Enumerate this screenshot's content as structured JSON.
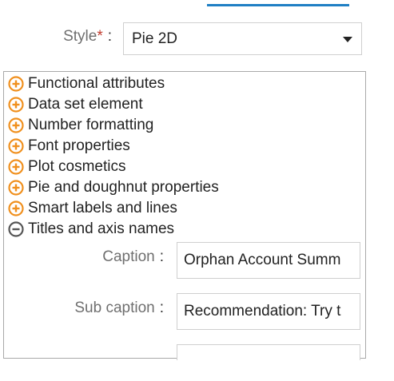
{
  "style": {
    "label": "Style",
    "required_mark": "*",
    "colon": ":",
    "selected": "Pie 2D"
  },
  "tree": [
    {
      "label": "Functional attributes",
      "state": "collapsed"
    },
    {
      "label": "Data set element",
      "state": "collapsed"
    },
    {
      "label": "Number formatting",
      "state": "collapsed"
    },
    {
      "label": "Font properties",
      "state": "collapsed"
    },
    {
      "label": "Plot cosmetics",
      "state": "collapsed"
    },
    {
      "label": "Pie and doughnut properties",
      "state": "collapsed"
    },
    {
      "label": "Smart labels and lines",
      "state": "collapsed"
    },
    {
      "label": "Titles and axis names",
      "state": "expanded"
    }
  ],
  "titles_section": {
    "caption": {
      "label": "Caption",
      "colon": ":",
      "value": "Orphan Account Summ"
    },
    "sub_caption": {
      "label": "Sub caption",
      "colon": ":",
      "value": "Recommendation: Try t"
    }
  },
  "colors": {
    "accent_blue": "#1f7fc4",
    "expand_orange": "#f0901e",
    "collapse_gray": "#555555",
    "required_red": "#c0392b"
  },
  "icons": {
    "collapsed": "plus-circle-icon",
    "expanded": "minus-circle-icon"
  }
}
